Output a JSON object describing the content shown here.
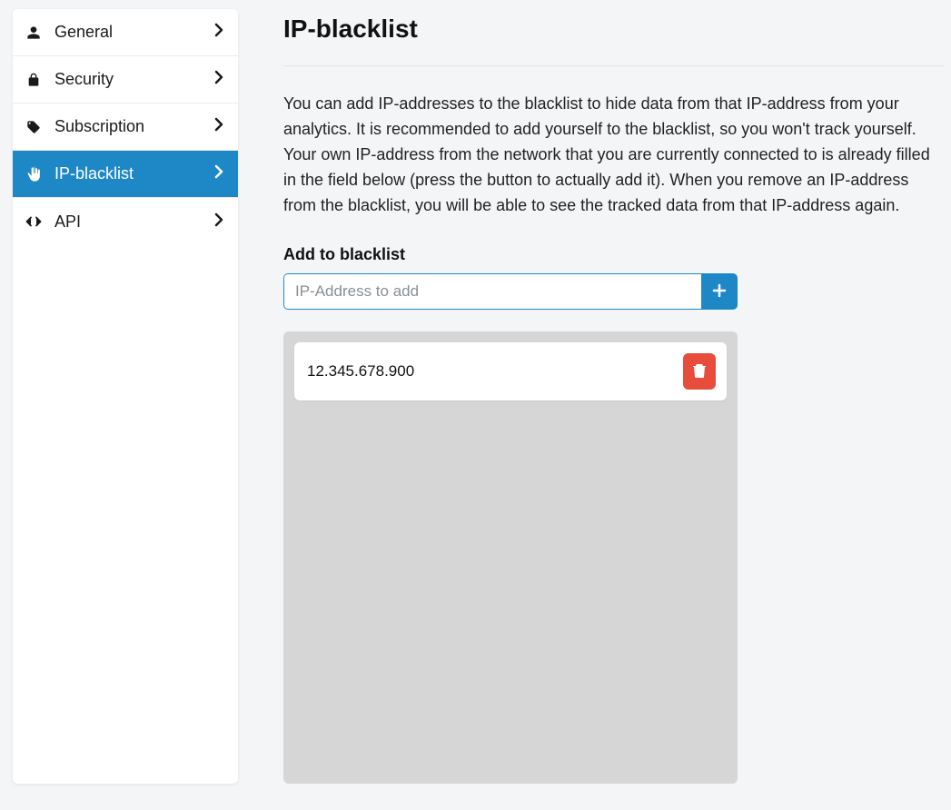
{
  "sidebar": {
    "items": [
      {
        "label": "General",
        "icon": "user-icon",
        "active": false
      },
      {
        "label": "Security",
        "icon": "lock-icon",
        "active": false
      },
      {
        "label": "Subscription",
        "icon": "tag-icon",
        "active": false
      },
      {
        "label": "IP-blacklist",
        "icon": "hand-icon",
        "active": true
      },
      {
        "label": "API",
        "icon": "code-icon",
        "active": false
      }
    ]
  },
  "page": {
    "title": "IP-blacklist",
    "description": "You can add IP-addresses to the blacklist to hide data from that IP-address from your analytics. It is recommended to add yourself to the blacklist, so you won't track yourself. Your own IP-address from the network that you are currently connected to is already filled in the field below (press the button to actually add it). When you remove an IP-address from the blacklist, you will be able to see the tracked data from that IP-address again."
  },
  "form": {
    "section_label": "Add to blacklist",
    "placeholder": "IP-Address to add",
    "value": ""
  },
  "blacklist": {
    "entries": [
      {
        "ip": "12.345.678.900"
      }
    ]
  }
}
